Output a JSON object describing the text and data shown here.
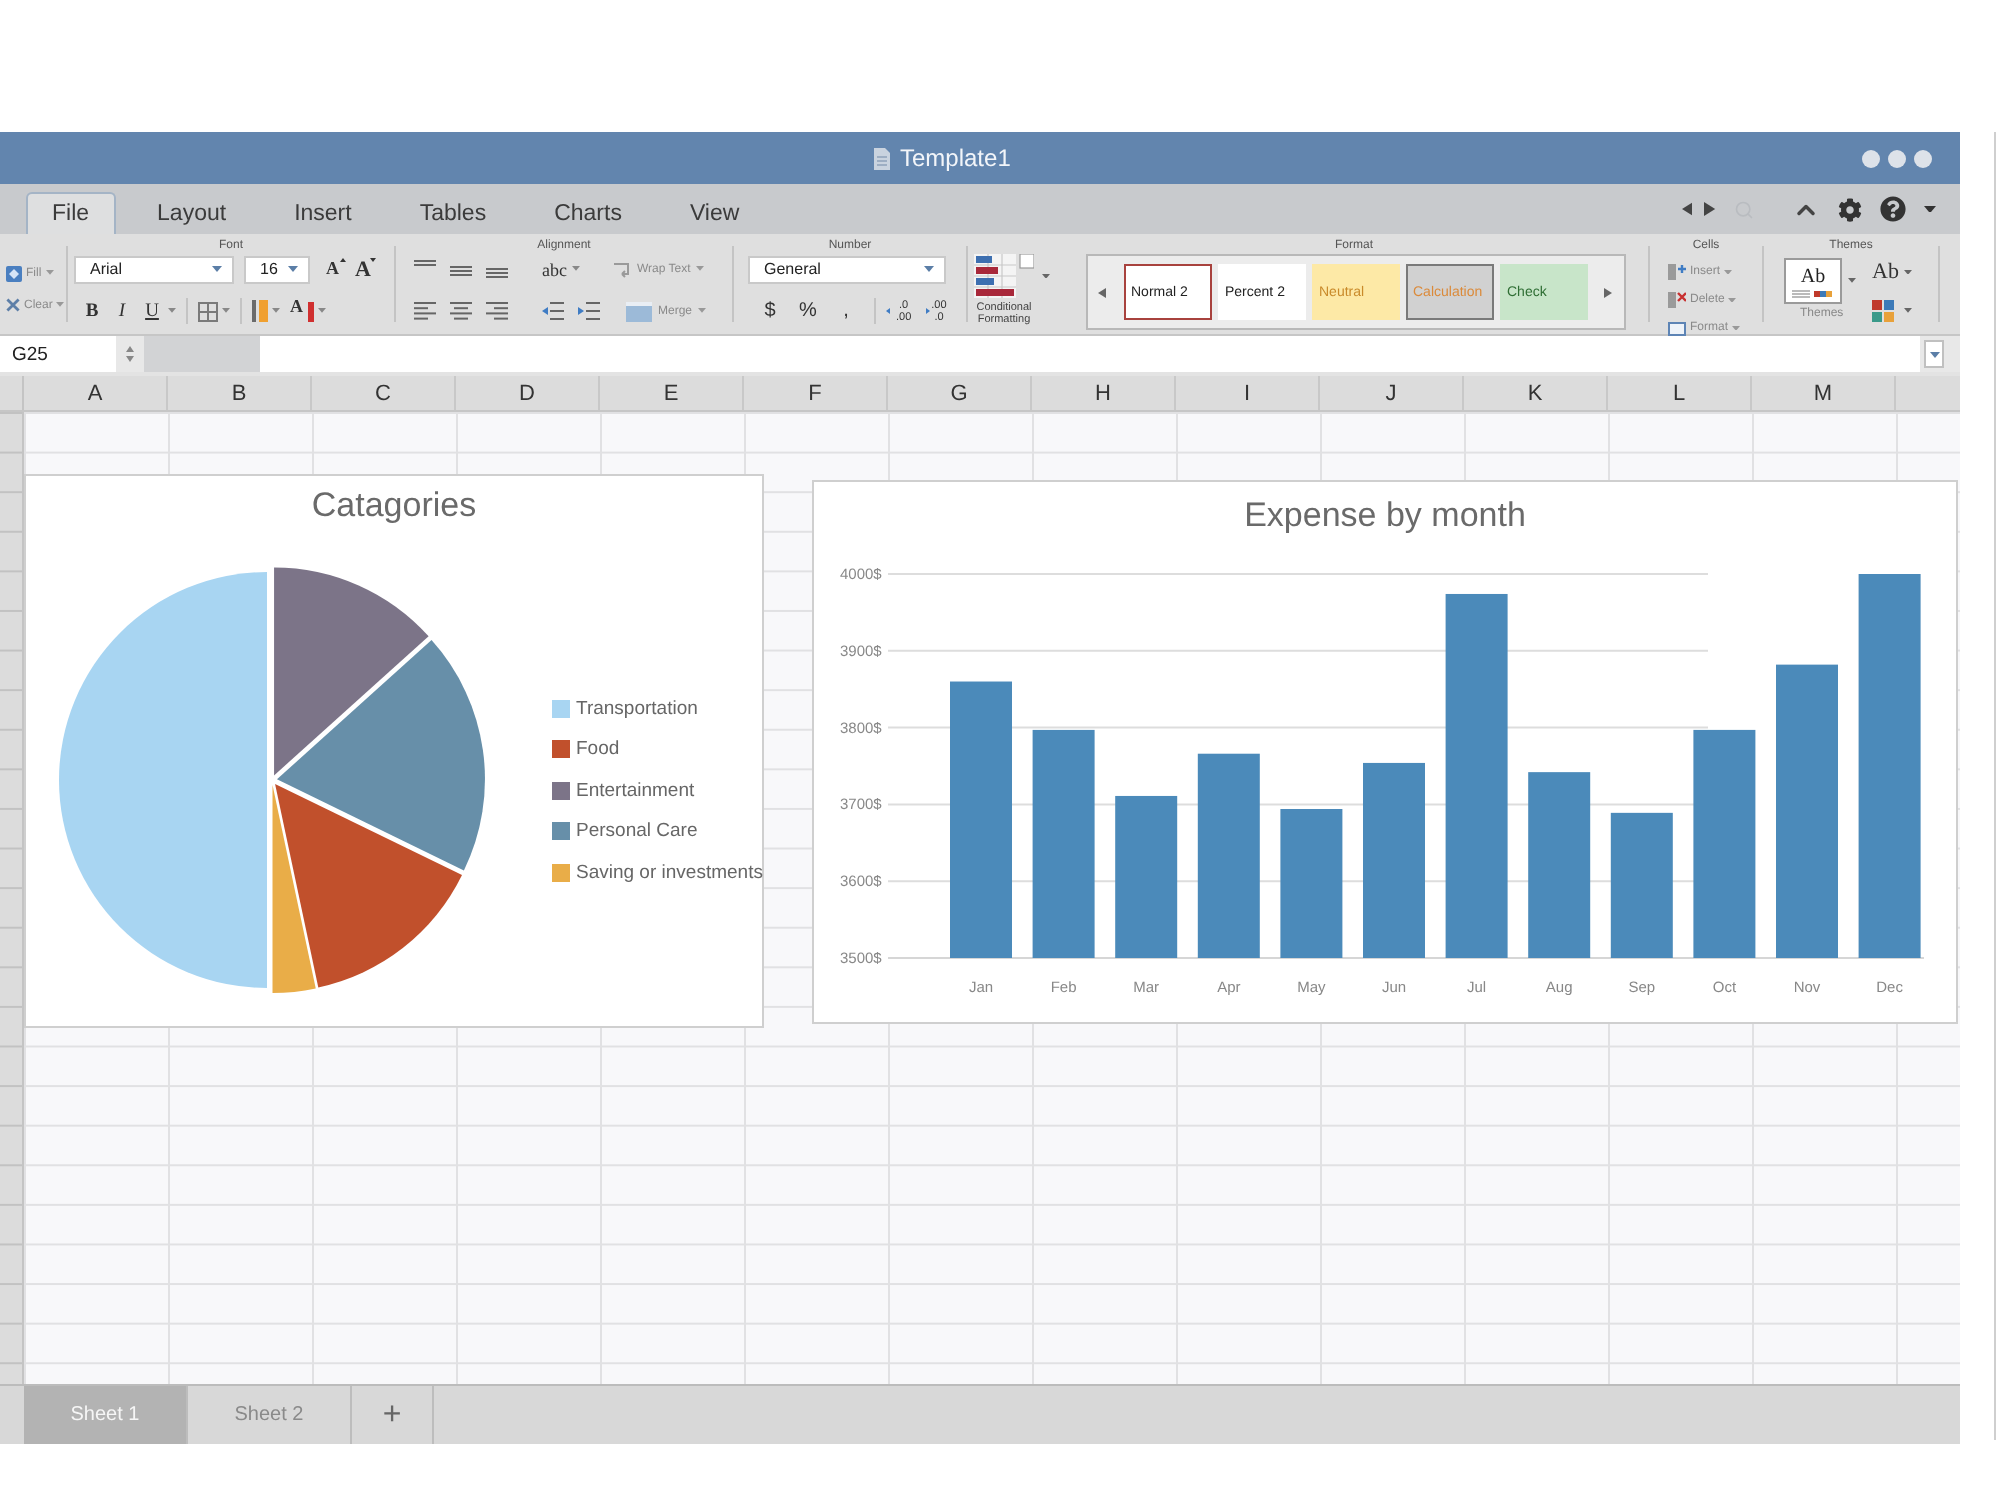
{
  "window": {
    "title": "Template1"
  },
  "ribbon_tabs": [
    {
      "label": "File",
      "selected": true
    },
    {
      "label": "Layout",
      "selected": false
    },
    {
      "label": "Insert",
      "selected": false
    },
    {
      "label": "Tables",
      "selected": false
    },
    {
      "label": "Charts",
      "selected": false
    },
    {
      "label": "View",
      "selected": false
    }
  ],
  "ribbon": {
    "edit": {
      "fill": "Fill",
      "clear": "Clear"
    },
    "font": {
      "label": "Font",
      "family": "Arial",
      "size": "16",
      "grow": "A",
      "shrink": "A",
      "bold": "B",
      "italic": "I",
      "underline": "U",
      "font_color": "A"
    },
    "alignment": {
      "label": "Alignment",
      "orientation": "abc",
      "wrap": "Wrap Text",
      "merge": "Merge"
    },
    "number": {
      "label": "Number",
      "format": "General",
      "symbols": [
        "$",
        "%",
        ","
      ],
      "decimals": [
        {
          "top": ".0",
          "bottom": ".00"
        },
        {
          "top": ".00",
          "bottom": ".0"
        }
      ]
    },
    "conditional_formatting": {
      "label": "Conditional Formatting"
    },
    "format": {
      "label": "Format",
      "styles": [
        {
          "label": "Normal 2",
          "kind": "normal"
        },
        {
          "label": "Percent 2",
          "kind": "percent"
        },
        {
          "label": "Neutral",
          "kind": "neutral"
        },
        {
          "label": "Calculation",
          "kind": "calculation"
        },
        {
          "label": "Check",
          "kind": "check"
        }
      ]
    },
    "cells": {
      "label": "Cells",
      "actions": [
        "Insert",
        "Delete",
        "Format"
      ]
    },
    "themes": {
      "label": "Themes",
      "preview": "Ab",
      "caption": "Themes",
      "fonts": "Ab"
    }
  },
  "formula_bar": {
    "cell": "G25"
  },
  "columns": [
    "A",
    "B",
    "C",
    "D",
    "E",
    "F",
    "G",
    "H",
    "I",
    "J",
    "K",
    "L",
    "M"
  ],
  "pie_chart": {
    "title": "Catagories",
    "legend": [
      {
        "label": "Transportation",
        "color": "#a8d5f2"
      },
      {
        "label": "Food",
        "color": "#c1502c"
      },
      {
        "label": "Entertainment",
        "color": "#7c7488"
      },
      {
        "label": "Personal Care",
        "color": "#678fa9"
      },
      {
        "label": "Saving or investments",
        "color": "#e9ad48"
      }
    ]
  },
  "bar_chart": {
    "chart_data": {
      "type": "bar",
      "title": "Expense by month",
      "categories": [
        "Jan",
        "Feb",
        "Mar",
        "Apr",
        "May",
        "Jun",
        "Jul",
        "Aug",
        "Sep",
        "Oct",
        "Nov",
        "Dec"
      ],
      "values": [
        3860,
        3797,
        3711,
        3766,
        3694,
        3754,
        3974,
        3742,
        3689,
        3797,
        3882,
        4000
      ],
      "ylim": [
        3500,
        4000
      ],
      "yticks": [
        {
          "value": 3500,
          "label": "3500$"
        },
        {
          "value": 3600,
          "label": "3600$"
        },
        {
          "value": 3700,
          "label": "3700$"
        },
        {
          "value": 3800,
          "label": "3800$"
        },
        {
          "value": 3900,
          "label": "3900$"
        },
        {
          "value": 4000,
          "label": "4000$"
        }
      ],
      "grid": true
    }
  },
  "sheet_tabs": [
    {
      "label": "Sheet 1",
      "selected": true
    },
    {
      "label": "Sheet 2",
      "selected": false
    }
  ],
  "add_sheet": "+"
}
